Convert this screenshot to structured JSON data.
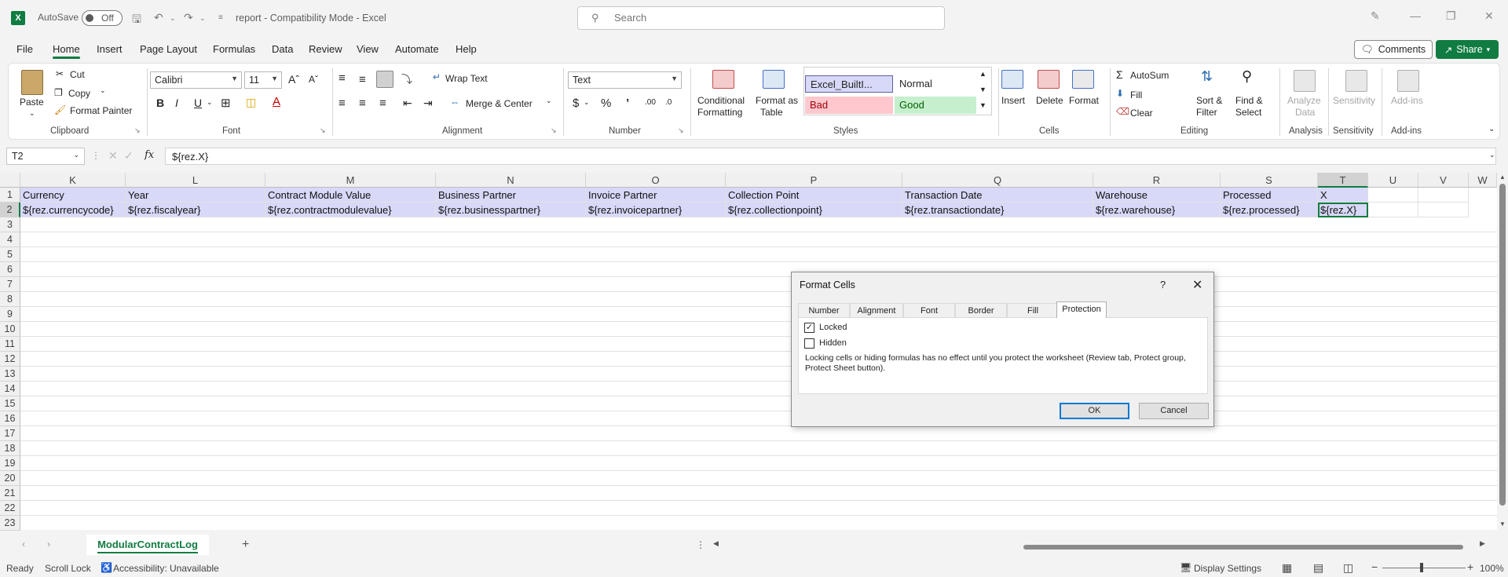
{
  "titlebar": {
    "autosave_label": "AutoSave",
    "autosave_state": "Off",
    "doc_title": "report  -  Compatibility Mode  -  Excel",
    "search_placeholder": "Search"
  },
  "menu": [
    "File",
    "Home",
    "Insert",
    "Page Layout",
    "Formulas",
    "Data",
    "Review",
    "View",
    "Automate",
    "Help"
  ],
  "menu_active": "Home",
  "comments_label": "Comments",
  "share_label": "Share",
  "ribbon": {
    "clipboard": {
      "paste": "Paste",
      "cut": "Cut",
      "copy": "Copy",
      "format_painter": "Format Painter",
      "label": "Clipboard"
    },
    "font": {
      "name": "Calibri",
      "size": "11",
      "label": "Font"
    },
    "alignment": {
      "wrap_text": "Wrap Text",
      "merge_center": "Merge & Center",
      "label": "Alignment"
    },
    "number": {
      "format": "Text",
      "label": "Number"
    },
    "styles": {
      "conditional": "Conditional",
      "formatting": "Formatting",
      "format_as": "Format as",
      "table": "Table",
      "style_builtin": "Excel_BuiltI...",
      "style_normal": "Normal",
      "style_bad": "Bad",
      "style_good": "Good",
      "label": "Styles"
    },
    "cells": {
      "insert": "Insert",
      "delete": "Delete",
      "format": "Format",
      "label": "Cells"
    },
    "editing": {
      "autosum": "AutoSum",
      "fill": "Fill",
      "clear": "Clear",
      "sort": "Sort &",
      "filter": "Filter",
      "find": "Find &",
      "select": "Select",
      "label": "Editing"
    },
    "analysis": {
      "analyze": "Analyze",
      "data": "Data",
      "label": "Analysis"
    },
    "sensitivity": {
      "sensitivity": "Sensitivity",
      "label": "Sensitivity"
    },
    "addins": {
      "addins": "Add-ins",
      "label": "Add-ins"
    }
  },
  "formula_bar": {
    "name_box": "T2",
    "fx": "fx",
    "formula": "${rez.X}"
  },
  "columns": [
    "K",
    "L",
    "M",
    "N",
    "O",
    "P",
    "Q",
    "R",
    "S",
    "T",
    "U",
    "V",
    "W"
  ],
  "rows": [
    "1",
    "2",
    "3",
    "4",
    "5",
    "6",
    "7",
    "8",
    "9",
    "10",
    "11",
    "12",
    "13",
    "14",
    "15",
    "16",
    "17",
    "18",
    "19",
    "20",
    "21",
    "22",
    "23"
  ],
  "row1": [
    "Currency",
    "Year",
    "Contract Module Value",
    "Business Partner",
    "Invoice Partner",
    "Collection Point",
    "Transaction Date",
    "Warehouse",
    "Processed",
    "X"
  ],
  "row2": [
    "${rez.currencycode}",
    "${rez.fiscalyear}",
    "${rez.contractmodulevalue}",
    "${rez.businesspartner}",
    "${rez.invoicepartner}",
    "${rez.collectionpoint}",
    "${rez.transactiondate}",
    "${rez.warehouse}",
    "${rez.processed}",
    "${rez.X}"
  ],
  "sheet_tab": "ModularContractLog",
  "status": {
    "ready": "Ready",
    "scroll_lock": "Scroll Lock",
    "accessibility": "Accessibility: Unavailable",
    "display_settings": "Display Settings",
    "zoom": "100%"
  },
  "dialog": {
    "title": "Format Cells",
    "help": "?",
    "tabs": [
      "Number",
      "Alignment",
      "Font",
      "Border",
      "Fill",
      "Protection"
    ],
    "active_tab": "Protection",
    "locked_label": "Locked",
    "locked_checked": true,
    "hidden_label": "Hidden",
    "hidden_checked": false,
    "info_text": "Locking cells or hiding formulas has no effect until you protect the worksheet (Review tab, Protect group, Protect Sheet button).",
    "ok": "OK",
    "cancel": "Cancel"
  },
  "colors": {
    "accent": "#107c41",
    "header_highlight": "#d8d8f8",
    "style_bad_bg": "#ffc7ce",
    "style_bad_fg": "#9c0006",
    "style_good_bg": "#c6efce",
    "style_good_fg": "#006100"
  }
}
